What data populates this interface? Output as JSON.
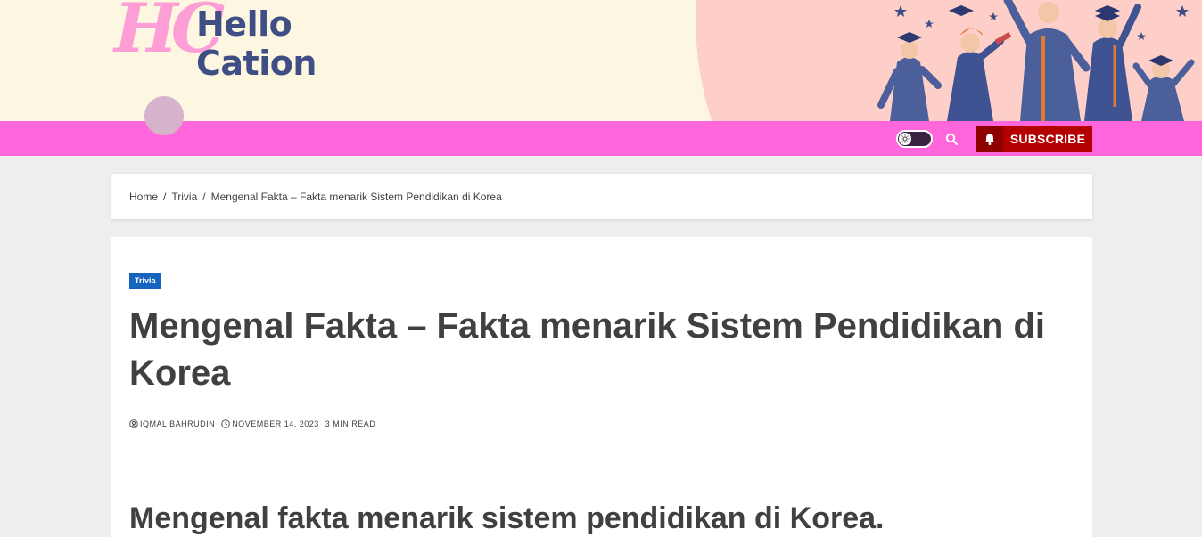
{
  "header": {
    "logo_mark": "HC",
    "logo_line1": "Hello",
    "logo_line2": "Cation"
  },
  "navbar": {
    "theme_toggle_icon": "sun-icon",
    "search_icon": "search-icon",
    "subscribe_icon": "bell-icon",
    "subscribe_label": "SUBSCRIBE"
  },
  "breadcrumb": {
    "items": [
      "Home",
      "Trivia",
      "Mengenal Fakta – Fakta menarik Sistem Pendidikan di Korea"
    ],
    "separator": "/"
  },
  "article": {
    "category": "Trivia",
    "title": "Mengenal Fakta – Fakta menarik Sistem Pendidikan di Korea",
    "author": "IQMAL BAHRUDIN",
    "date": "NOVEMBER 14, 2023",
    "read_time": "3 MIN READ",
    "subheading": "Mengenal fakta menarik sistem pendidikan di Korea."
  },
  "colors": {
    "navbar": "#ff66dc",
    "banner_bg": "#fdf7e2",
    "subscribe": "#b40000",
    "category_badge": "#1565c0",
    "logo_text": "#3f4f86",
    "logo_mark": "#fd9fd6"
  }
}
